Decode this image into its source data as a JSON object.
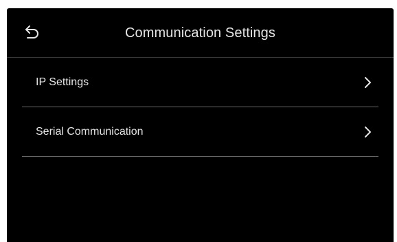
{
  "header": {
    "title": "Communication Settings",
    "back_icon": "back-arrow-icon"
  },
  "menu": {
    "items": [
      {
        "label": "IP Settings",
        "icon": "chevron-right-icon"
      },
      {
        "label": "Serial Communication",
        "icon": "chevron-right-icon"
      }
    ]
  },
  "colors": {
    "background": "#000000",
    "text": "#e6e6e6",
    "divider": "#6a6a6a"
  }
}
